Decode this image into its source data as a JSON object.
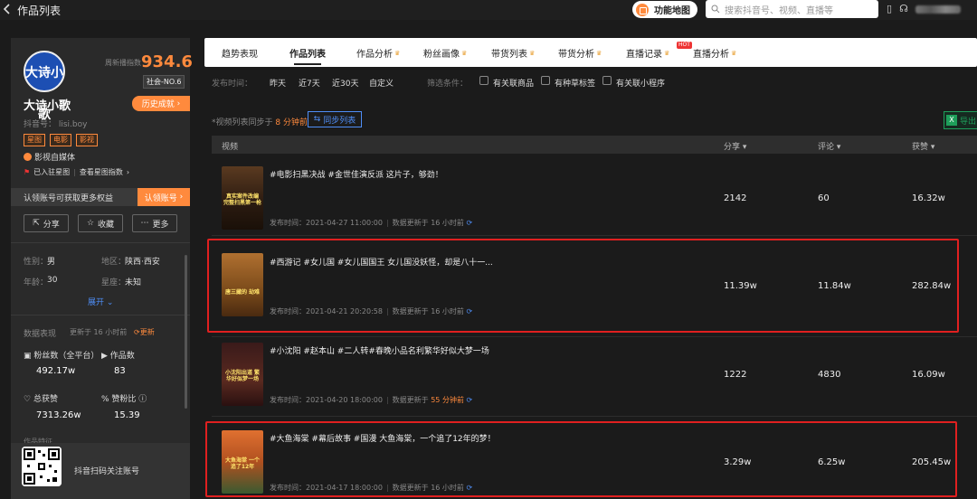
{
  "topbar": {
    "page_title": "作品列表",
    "func_map": "功能地图",
    "search_placeholder": "搜索抖音号、视频、直播等"
  },
  "profile": {
    "avatar_text": "大诗小歌",
    "index_label": "周新播指数",
    "index_value": "934.6",
    "rank": "社会-NO.6",
    "history_btn": "历史成就",
    "name": "大诗小歌",
    "douyin_id": "抖音号： lisi.boy",
    "tags": [
      "星图",
      "电影",
      "影视"
    ],
    "self_media": "影视自媒体",
    "settled": "已入驻星图",
    "view_index": "查看星图指数",
    "claim_text": "认领账号可获取更多权益",
    "claim_btn": "认领账号",
    "share": "分享",
    "favorite": "收藏",
    "more": "更多",
    "gender_label": "性别：",
    "gender": "男",
    "region_label": "地区：",
    "region": "陕西·西安",
    "age_label": "年龄：",
    "age": "30",
    "constellation_label": "星座：",
    "constellation": "未知",
    "expand": "展开",
    "data_title": "数据表现",
    "data_updated": "更新于 16 小时前",
    "data_refresh": "更新",
    "fans_label": "粉丝数（全平台）",
    "fans_value": "492.17w",
    "works_label": "作品数",
    "works_value": "83",
    "likes_label": "总获赞",
    "likes_value": "7313.26w",
    "ratio_label": "赞粉比",
    "ratio_value": "15.39",
    "works_section": "作品特征",
    "qr_text": "抖音扫码关注账号"
  },
  "tabs": [
    {
      "label": "趋势表现"
    },
    {
      "label": "作品列表"
    },
    {
      "label": "作品分析"
    },
    {
      "label": "粉丝画像"
    },
    {
      "label": "带货列表"
    },
    {
      "label": "带货分析"
    },
    {
      "label": "直播记录"
    },
    {
      "label": "直播分析"
    }
  ],
  "hot_badge": "HOT",
  "filters": {
    "time_label": "发布时间：",
    "time_options": [
      "昨天",
      "近7天",
      "近30天",
      "自定义"
    ],
    "cond_label": "筛选条件：",
    "cond_options": [
      "有关联商品",
      "有种草标签",
      "有关联小程序"
    ]
  },
  "sync": {
    "note_prefix": "*视频列表同步于",
    "note_time": "8 分钟前",
    "button": "同步列表",
    "export": "导出"
  },
  "table": {
    "headers": [
      "视频",
      "分享",
      "评论",
      "获赞"
    ],
    "rows": [
      {
        "title": "#电影扫黑决战 #金世佳演反派 这片子，够劲！",
        "thumb_caption": "真实案件改编 完整扫黑第一枪",
        "date": "发布时间：2021-04-27 11:00:00",
        "update": "数据更新于 16 小时前",
        "share": "2142",
        "comment": "60",
        "likes": "16.32w",
        "thumb_color": "#3a2a1a",
        "highlighted": false
      },
      {
        "title": "#西游记 #女儿国 #女儿国国王 女儿国没妖怪，却是八十一...",
        "thumb_caption": "唐三藏的 劫难",
        "date": "发布时间：2021-04-21 20:20:58",
        "update": "数据更新于 16 小时前",
        "share": "11.39w",
        "comment": "11.84w",
        "likes": "282.84w",
        "thumb_color": "#8a5a2a",
        "highlighted": true
      },
      {
        "title": "#小沈阳 #赵本山 #二人转#春晚小品名利繁华好似大梦一场",
        "thumb_caption": "小沈阳出道 繁华好似梦一场",
        "date": "发布时间：2021-04-20 18:00:00",
        "update": "数据更新于",
        "update_time": "55 分钟前",
        "share": "1222",
        "comment": "4830",
        "likes": "16.09w",
        "thumb_color": "#4a2020",
        "highlighted": false
      },
      {
        "title": "#大鱼海棠 #幕后故事 #国漫 大鱼海棠，一个追了12年的梦！",
        "thumb_caption": "大鱼海棠 一个追了12年",
        "date": "发布时间：2021-04-17 18:00:00",
        "update": "数据更新于 16 小时前",
        "share": "3.29w",
        "comment": "6.25w",
        "likes": "205.45w",
        "thumb_color": "#c05020",
        "highlighted": true
      }
    ]
  },
  "colors": {
    "accent": "#ff8a3d",
    "link": "#4f8ef7",
    "highlight": "#e02020"
  }
}
